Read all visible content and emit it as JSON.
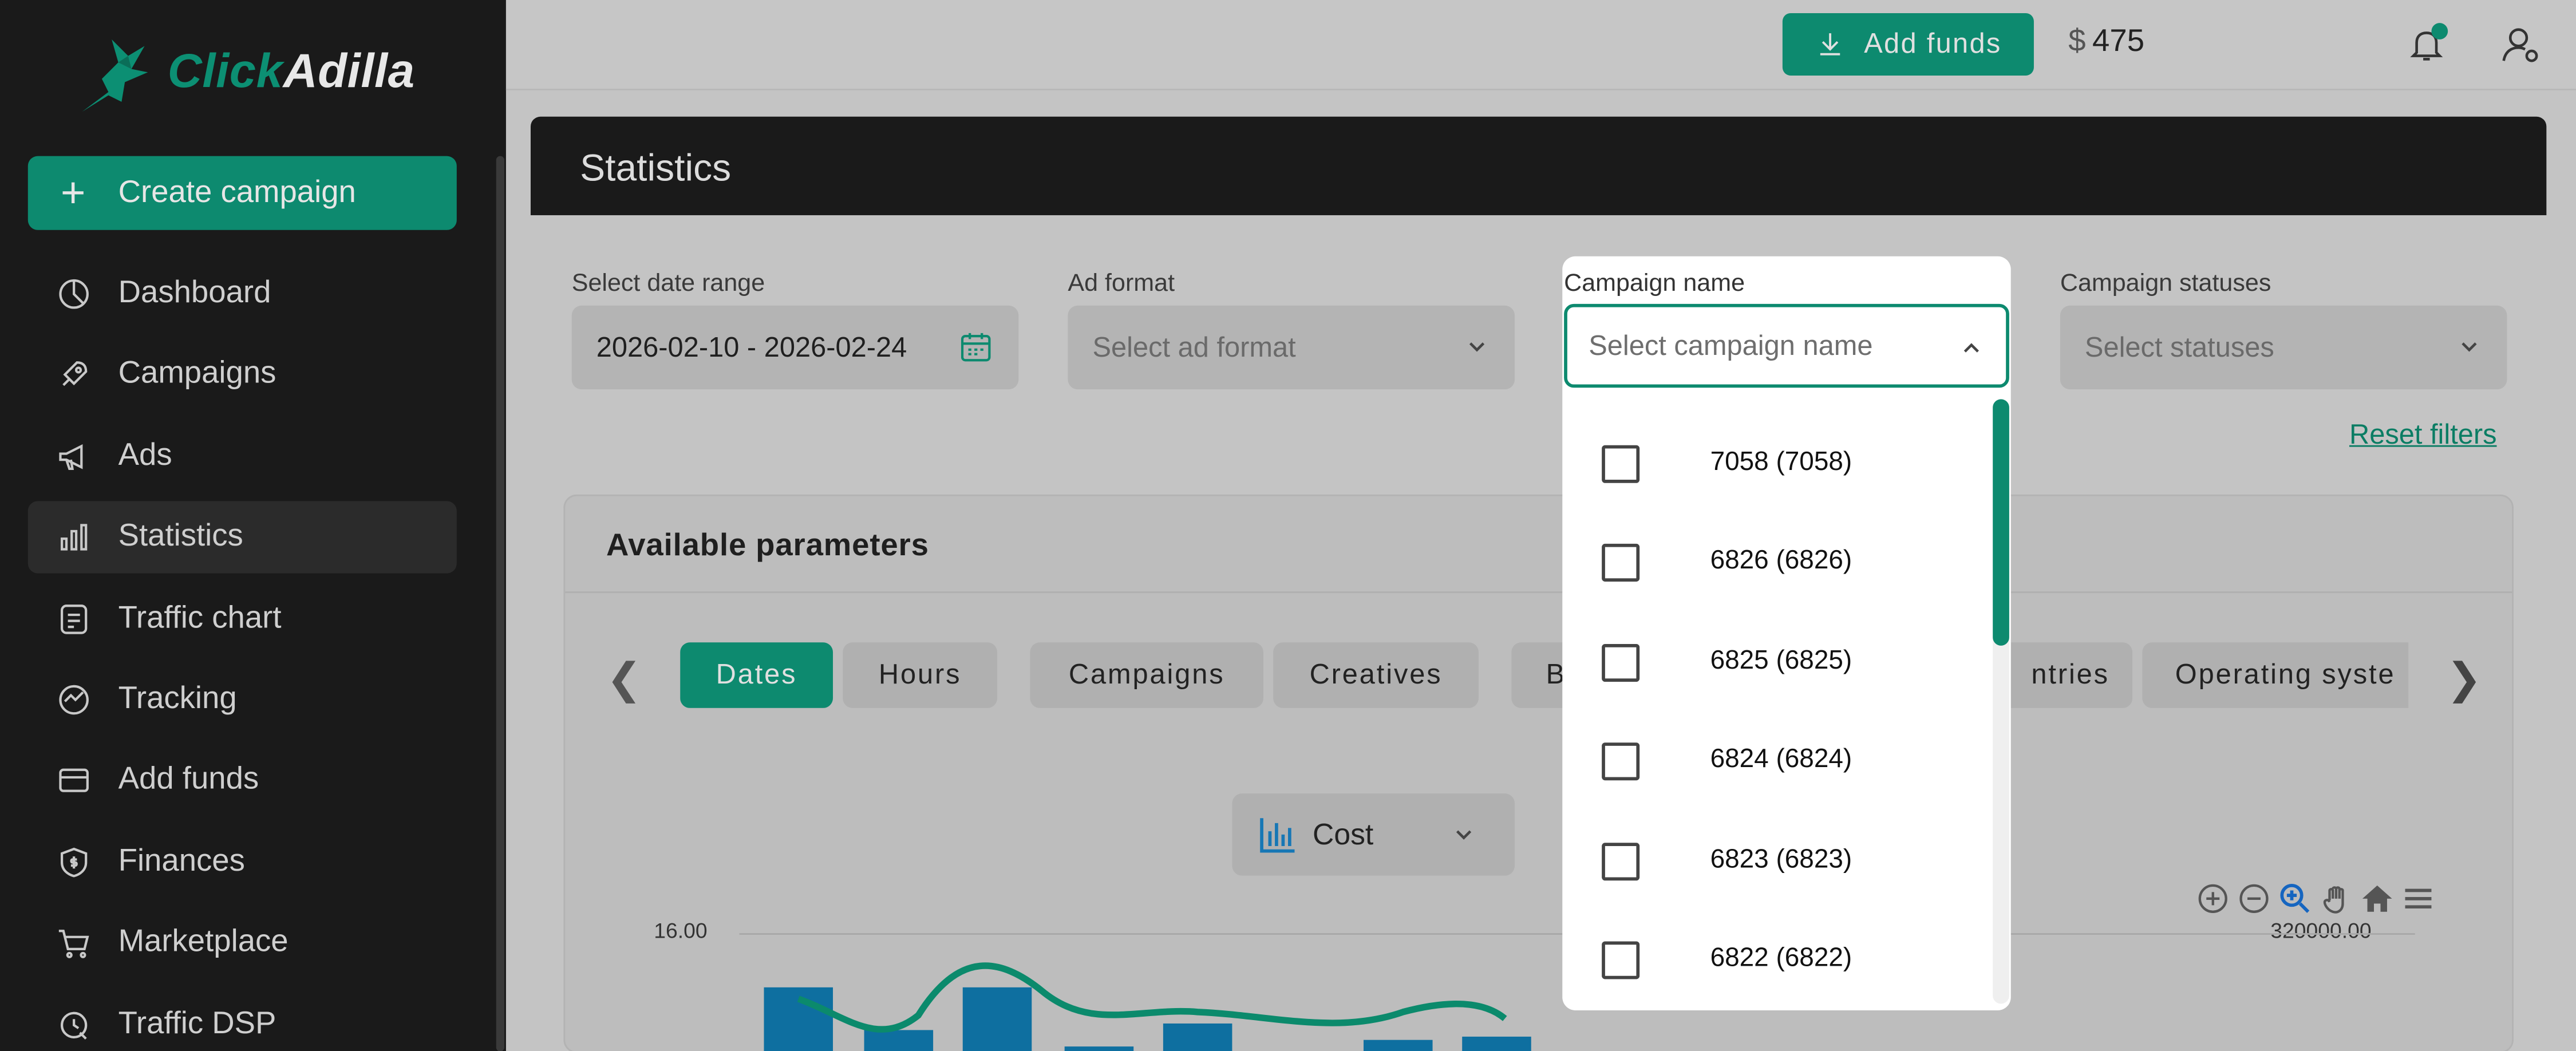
{
  "brand": {
    "name_part1": "Click",
    "name_part2": "Adilla",
    "accent_color": "#0d8a6f"
  },
  "sidebar": {
    "create_label": "Create campaign",
    "items": [
      {
        "label": "Dashboard",
        "icon": "dashboard-icon"
      },
      {
        "label": "Campaigns",
        "icon": "rocket-icon"
      },
      {
        "label": "Ads",
        "icon": "megaphone-icon"
      },
      {
        "label": "Statistics",
        "icon": "bar-chart-icon",
        "active": true
      },
      {
        "label": "Traffic chart",
        "icon": "document-list-icon"
      },
      {
        "label": "Tracking",
        "icon": "tracking-icon"
      },
      {
        "label": "Add funds",
        "icon": "wallet-icon"
      },
      {
        "label": "Finances",
        "icon": "shield-dollar-icon"
      },
      {
        "label": "Marketplace",
        "icon": "cart-icon"
      },
      {
        "label": "Traffic DSP",
        "icon": "dsp-icon"
      }
    ]
  },
  "header": {
    "add_funds_label": "Add funds",
    "currency": "$",
    "balance": "475",
    "bell_icon": "bell-icon",
    "user_icon": "user-settings-icon"
  },
  "page": {
    "title": "Statistics"
  },
  "filters": {
    "date_range": {
      "label": "Select date range",
      "value": "2026-02-10 - 2026-02-24"
    },
    "ad_format": {
      "label": "Ad format",
      "placeholder": "Select ad format"
    },
    "campaign_name": {
      "label": "Campaign name",
      "placeholder": "Select campaign name"
    },
    "campaign_statuses": {
      "label": "Campaign statuses",
      "placeholder": "Select statuses"
    },
    "reset_label": "Reset filters"
  },
  "params": {
    "title": "Available parameters",
    "tabs": [
      "Dates",
      "Hours",
      "Campaigns",
      "Creatives",
      "B",
      "ntries",
      "Operating syste"
    ],
    "active_tab": "Dates"
  },
  "chart": {
    "metric": "Cost",
    "left_axis_top": "16.00",
    "right_axis_top": "320000.00"
  },
  "dropdown": {
    "options": [
      "7058 (7058)",
      "6826 (6826)",
      "6825 (6825)",
      "6824 (6824)",
      "6823 (6823)",
      "6822 (6822)"
    ]
  }
}
